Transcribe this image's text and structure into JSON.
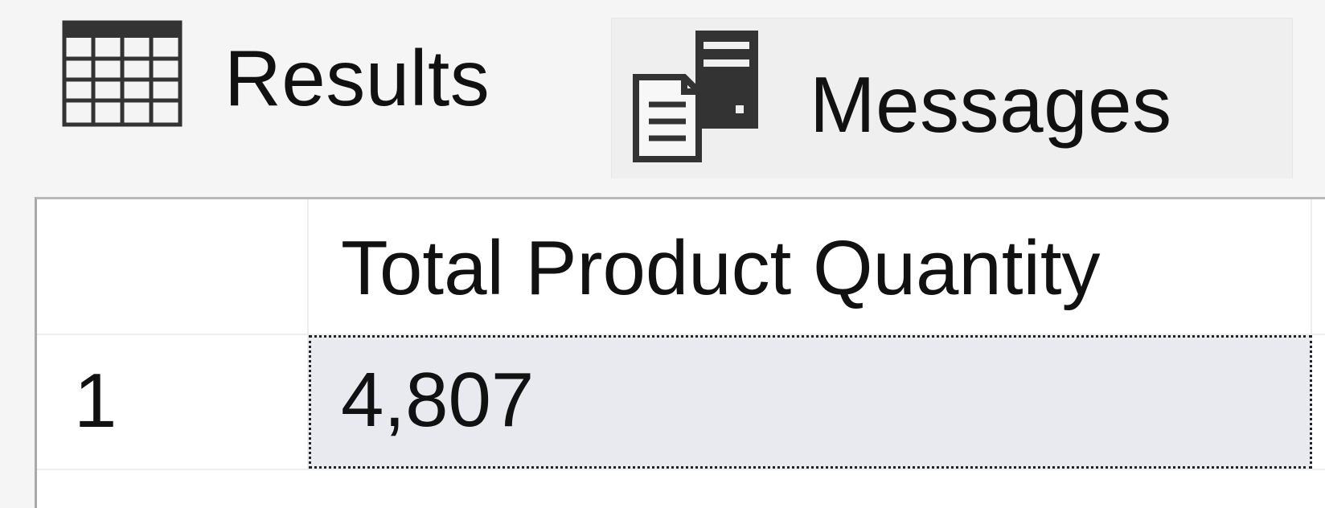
{
  "tabs": [
    {
      "label": "Results",
      "icon": "grid-icon",
      "selected": true
    },
    {
      "label": "Messages",
      "icon": "messages-icon",
      "selected": false
    }
  ],
  "results": {
    "columns": [
      "Total Product Quantity"
    ],
    "rows": [
      {
        "row_number": "1",
        "cells": [
          "4,807"
        ]
      }
    ],
    "selected_cell": {
      "row": 0,
      "column": 0
    }
  },
  "colors": {
    "background": "#f5f5f5",
    "grid_background": "#ffffff",
    "selected_cell_background": "#e8eaef",
    "icon_dark": "#2f2f2f",
    "grid_lines": "#eeeeee"
  }
}
